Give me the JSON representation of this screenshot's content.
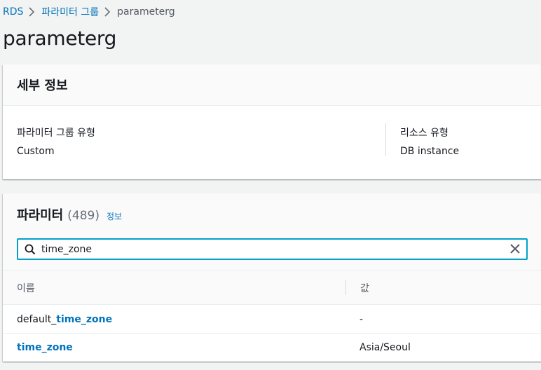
{
  "breadcrumb": {
    "items": [
      "RDS",
      "파라미터 그룹"
    ],
    "current": "parameterg"
  },
  "page": {
    "title": "parameterg"
  },
  "details": {
    "header": "세부 정보",
    "param_group_type_label": "파라미터 그룹 유형",
    "param_group_type_value": "Custom",
    "resource_type_label": "리소스 유형",
    "resource_type_value": "DB instance"
  },
  "parameters": {
    "title": "파라미터",
    "count": "(489)",
    "info_link": "정보",
    "search": {
      "value": "time_zone",
      "placeholder": ""
    },
    "columns": [
      "이름",
      "값"
    ],
    "rows": [
      {
        "name_prefix": "default_",
        "name_match": "time_zone",
        "value": "-"
      },
      {
        "name_prefix": "",
        "name_match": "time_zone",
        "value": "Asia/Seoul"
      }
    ]
  },
  "colors": {
    "link": "#0073bb",
    "focus": "#00a1c9",
    "text": "#16191f",
    "muted": "#545b64"
  },
  "icons": {
    "breadcrumb_separator": "chevron-right-icon",
    "search": "search-icon",
    "clear": "close-icon"
  }
}
